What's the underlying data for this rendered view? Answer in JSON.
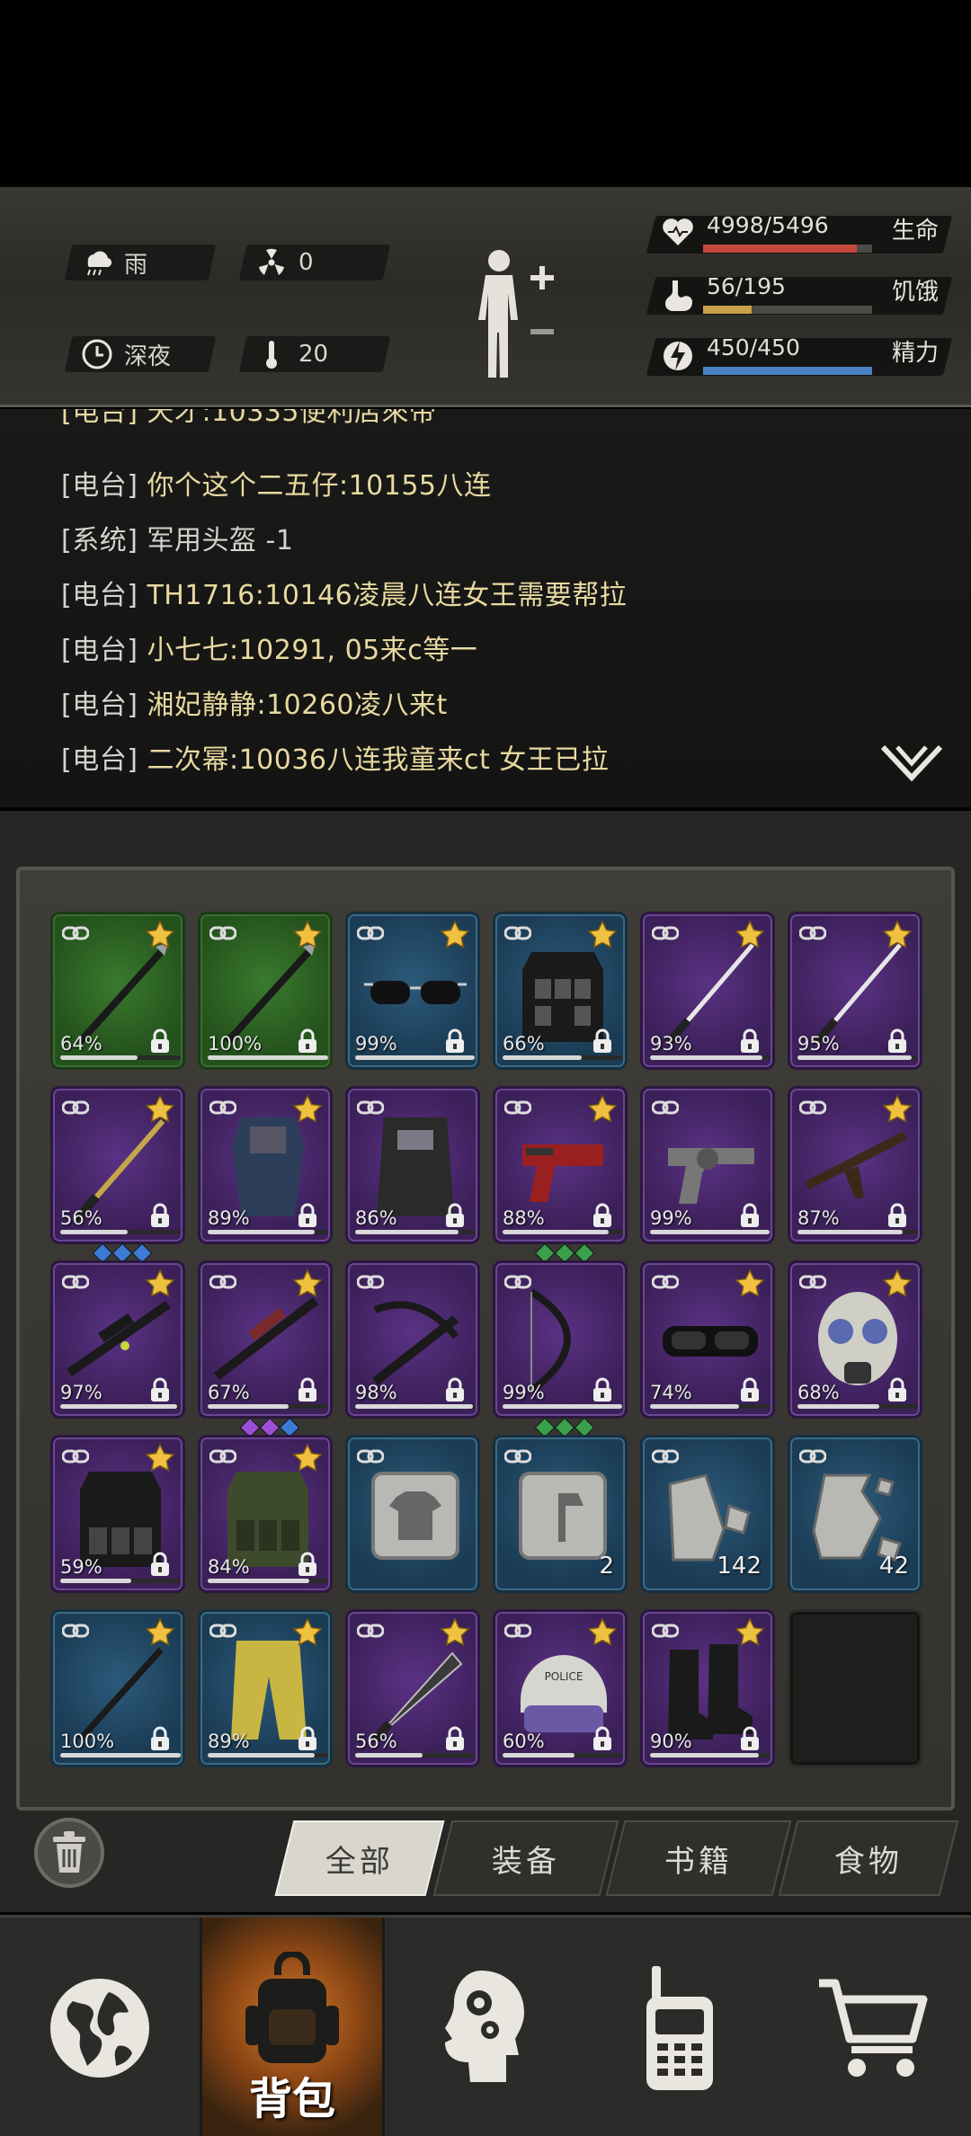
{
  "status": {
    "weather": "雨",
    "radiation": "0",
    "time_of_day": "深夜",
    "temperature": "20",
    "health": {
      "value": "4998/5496",
      "label": "生命",
      "fraction": 0.909,
      "color": "#c4483c"
    },
    "hunger": {
      "value": "56/195",
      "label": "饥饿",
      "fraction": 0.287,
      "color": "#c9a04a"
    },
    "energy": {
      "value": "450/450",
      "label": "精力",
      "fraction": 1.0,
      "color": "#4a82c4"
    }
  },
  "chat": {
    "partial_line": "[电台] 天才:10335便利店來帝",
    "lines": [
      {
        "tag": "[电台]",
        "message": "你个这个二五仔:10155八连",
        "type": "radio"
      },
      {
        "tag": "[系统]",
        "message": "军用头盔 -1",
        "type": "system"
      },
      {
        "tag": "[电台]",
        "message": "TH1716:10146凌晨八连女王需要帮拉",
        "type": "radio"
      },
      {
        "tag": "[电台]",
        "message": "小七七:10291, 05来c等一",
        "type": "radio"
      },
      {
        "tag": "[电台]",
        "message": "湘妃静静:10260凌八来t",
        "type": "radio"
      },
      {
        "tag": "[电台]",
        "message": "二次幂:10036八连我童来ct 女王已拉",
        "type": "radio"
      }
    ]
  },
  "inventory": {
    "items": [
      {
        "name": "spear",
        "rarity": "green",
        "durability": "64%",
        "fraction": 0.64,
        "starred": true,
        "locked": true
      },
      {
        "name": "spear",
        "rarity": "green",
        "durability": "100%",
        "fraction": 1.0,
        "starred": true,
        "locked": true
      },
      {
        "name": "sunglasses",
        "rarity": "blue",
        "durability": "99%",
        "fraction": 0.99,
        "starred": true,
        "locked": true
      },
      {
        "name": "tactical-vest",
        "rarity": "blue",
        "durability": "66%",
        "fraction": 0.66,
        "starred": true,
        "locked": true
      },
      {
        "name": "katana",
        "rarity": "purple",
        "durability": "93%",
        "fraction": 0.93,
        "starred": true,
        "locked": true
      },
      {
        "name": "katana",
        "rarity": "purple",
        "durability": "95%",
        "fraction": 0.95,
        "starred": true,
        "locked": true
      },
      {
        "name": "ornate-sword",
        "rarity": "purple",
        "durability": "56%",
        "fraction": 0.56,
        "starred": true,
        "locked": true,
        "gems": [
          "#3b7bd6",
          "#3b7bd6",
          "#3b7bd6"
        ]
      },
      {
        "name": "riot-shield",
        "rarity": "purple",
        "durability": "89%",
        "fraction": 0.89,
        "starred": true,
        "locked": true
      },
      {
        "name": "riot-shield-visor",
        "rarity": "purple",
        "durability": "86%",
        "fraction": 0.86,
        "starred": false,
        "locked": true
      },
      {
        "name": "red-pistol",
        "rarity": "purple",
        "durability": "88%",
        "fraction": 0.88,
        "starred": true,
        "locked": true,
        "gems": [
          "#3aa04a",
          "#3aa04a",
          "#3aa04a"
        ]
      },
      {
        "name": "revolver",
        "rarity": "purple",
        "durability": "99%",
        "fraction": 0.99,
        "starred": false,
        "locked": true
      },
      {
        "name": "assault-rifle",
        "rarity": "purple",
        "durability": "87%",
        "fraction": 0.87,
        "starred": true,
        "locked": true
      },
      {
        "name": "scoped-rifle",
        "rarity": "purple",
        "durability": "97%",
        "fraction": 0.97,
        "starred": true,
        "locked": true
      },
      {
        "name": "sniper-rifle",
        "rarity": "purple",
        "durability": "67%",
        "fraction": 0.67,
        "starred": true,
        "locked": true,
        "gems": [
          "#9b4fd6",
          "#9b4fd6",
          "#3b7bd6"
        ]
      },
      {
        "name": "crossbow",
        "rarity": "purple",
        "durability": "98%",
        "fraction": 0.98,
        "starred": false,
        "locked": true
      },
      {
        "name": "compound-bow",
        "rarity": "purple",
        "durability": "99%",
        "fraction": 0.99,
        "starred": false,
        "locked": true,
        "gems": [
          "#3aa04a",
          "#3aa04a",
          "#3aa04a"
        ]
      },
      {
        "name": "goggles",
        "rarity": "purple",
        "durability": "74%",
        "fraction": 0.74,
        "starred": true,
        "locked": true
      },
      {
        "name": "gas-mask",
        "rarity": "purple",
        "durability": "68%",
        "fraction": 0.68,
        "starred": true,
        "locked": true
      },
      {
        "name": "plate-carrier",
        "rarity": "purple",
        "durability": "59%",
        "fraction": 0.59,
        "starred": true,
        "locked": true
      },
      {
        "name": "camo-vest",
        "rarity": "purple",
        "durability": "84%",
        "fraction": 0.84,
        "starred": true,
        "locked": true
      },
      {
        "name": "shirt-blueprint",
        "rarity": "blue",
        "durability": "",
        "starred": false,
        "locked": false
      },
      {
        "name": "axe-blueprint",
        "rarity": "blue",
        "durability": "",
        "starred": false,
        "locked": false,
        "count": "2"
      },
      {
        "name": "stone-shard",
        "rarity": "blue",
        "durability": "",
        "starred": false,
        "locked": false,
        "count": "142"
      },
      {
        "name": "metal-shard",
        "rarity": "blue",
        "durability": "",
        "starred": false,
        "locked": false,
        "count": "42"
      },
      {
        "name": "iron-rod",
        "rarity": "blue",
        "durability": "100%",
        "fraction": 1.0,
        "starred": true,
        "locked": true
      },
      {
        "name": "yellow-pants",
        "rarity": "blue",
        "durability": "89%",
        "fraction": 0.89,
        "starred": true,
        "locked": true
      },
      {
        "name": "machete",
        "rarity": "purple",
        "durability": "56%",
        "fraction": 0.56,
        "starred": true,
        "locked": true
      },
      {
        "name": "police-helmet",
        "rarity": "purple",
        "durability": "60%",
        "fraction": 0.6,
        "starred": true,
        "locked": true
      },
      {
        "name": "combat-boots",
        "rarity": "purple",
        "durability": "90%",
        "fraction": 0.9,
        "starred": true,
        "locked": true
      },
      {
        "name": "empty",
        "rarity": "empty"
      }
    ],
    "police_text": "POLICE"
  },
  "filters": {
    "tabs": [
      "全部",
      "装备",
      "书籍",
      "食物"
    ],
    "active": 0
  },
  "nav": {
    "bag_label": "背包",
    "items": [
      "world-map",
      "backpack",
      "skills",
      "radio",
      "shop"
    ]
  }
}
